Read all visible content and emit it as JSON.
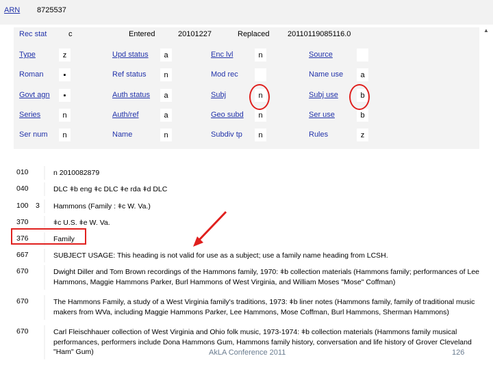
{
  "header": {
    "arn_label": "ARN",
    "arn_value": "8725537"
  },
  "fixed_fields": {
    "rec_stat": {
      "label": "Rec stat",
      "value": "c"
    },
    "entered": {
      "label": "Entered",
      "value": "20101227"
    },
    "replaced": {
      "label": "Replaced",
      "value": "20110119085116.0"
    },
    "rows": [
      [
        {
          "label": "Type",
          "value": "z"
        },
        {
          "label": "Upd status",
          "value": "a"
        },
        {
          "label": "Enc lvl",
          "value": "n"
        },
        {
          "label": "Source",
          "value": ""
        }
      ],
      [
        {
          "label": "Roman",
          "value": "▪"
        },
        {
          "label": "Ref status",
          "value": "n"
        },
        {
          "label": "Mod rec",
          "value": ""
        },
        {
          "label": "Name use",
          "value": "a"
        }
      ],
      [
        {
          "label": "Govt agn",
          "value": "▪"
        },
        {
          "label": "Auth status",
          "value": "a"
        },
        {
          "label": "Subj",
          "value": "n"
        },
        {
          "label": "Subj use",
          "value": "b"
        }
      ],
      [
        {
          "label": "Series",
          "value": "n"
        },
        {
          "label": "Auth/ref",
          "value": "a"
        },
        {
          "label": "Geo subd",
          "value": "n"
        },
        {
          "label": "Ser use",
          "value": "b"
        }
      ],
      [
        {
          "label": "Ser num",
          "value": "n"
        },
        {
          "label": "Name",
          "value": "n"
        },
        {
          "label": "Subdiv tp",
          "value": "n"
        },
        {
          "label": "Rules",
          "value": "z"
        }
      ]
    ]
  },
  "records": [
    {
      "tag": "010",
      "ind1": "",
      "ind2": "",
      "content": "n 2010082879"
    },
    {
      "tag": "040",
      "ind1": "",
      "ind2": "",
      "content": "DLC ǂb eng ǂc DLC ǂe rda ǂd DLC"
    },
    {
      "tag": "100",
      "ind1": "3",
      "ind2": "",
      "content": "Hammons (Family : ǂc W. Va.)"
    },
    {
      "tag": "370",
      "ind1": "",
      "ind2": "",
      "content": "ǂc U.S. ǂe W. Va."
    },
    {
      "tag": "376",
      "ind1": "",
      "ind2": "",
      "content": "Family"
    },
    {
      "tag": "667",
      "ind1": "",
      "ind2": "",
      "content": "SUBJECT USAGE:  This heading is not valid for use as a subject; use a family name heading from LCSH."
    },
    {
      "tag": "670",
      "ind1": "",
      "ind2": "",
      "content": "Dwight Diller and Tom Brown recordings of the Hammons family, 1970: ǂb collection materials (Hammons family; performances of Lee Hammons, Maggie Hammons Parker, Burl Hammons of West Virginia, and William Moses \"Mose\" Coffman)"
    },
    {
      "tag": "670",
      "ind1": "",
      "ind2": "",
      "content": "The Hammons Family, a study of a West Virginia family's traditions, 1973: ǂb liner notes (Hammons family, family of traditional music makers from WVa, including Maggie Hammons Parker, Lee Hammons, Mose Coffman, Burl Hammons, Sherman Hammons)"
    },
    {
      "tag": "670",
      "ind1": "",
      "ind2": "",
      "content": "Carl Fleischhauer collection of West Virginia and Ohio folk music, 1973-1974: ǂb collection materials (Hammons family musical performances, performers include Dona Hammons Gum, Hammons family history, conversation and life history of Grover Cleveland \"Ham\" Gum)"
    }
  ],
  "footer": {
    "conference": "AkLA Conference 2011",
    "page": "126"
  },
  "annotation_color": "#e0201e"
}
